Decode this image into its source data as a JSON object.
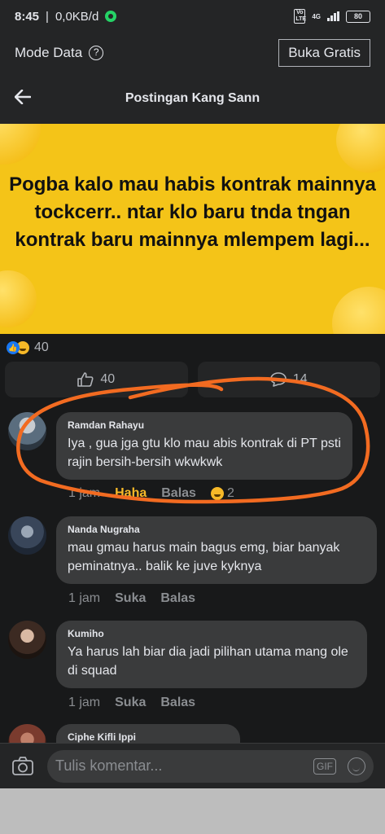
{
  "status_bar": {
    "time": "8:45",
    "speed": "0,0KB/d",
    "network": "4G",
    "volte": "Vo LTE",
    "battery": "80"
  },
  "mode_bar": {
    "label": "Mode Data",
    "help_icon": "question-icon",
    "button": "Buka Gratis"
  },
  "header": {
    "back_icon": "arrow-left-icon",
    "title": "Postingan Kang Sann"
  },
  "post": {
    "text": "Pogba kalo mau habis kontrak mainnya tockcerr.. ntar klo baru tnda tngan kontrak baru mainnya mlempem lagi...",
    "background_color": "#f4c418"
  },
  "reactions": {
    "icons": [
      "like-icon",
      "haha-icon"
    ],
    "count": "40"
  },
  "actions": {
    "like_count": "40",
    "comment_count": "14"
  },
  "comments": [
    {
      "name": "Ramdan Rahayu",
      "text": "Iya , gua jga gtu klo mau abis kontrak di PT psti rajin bersih-bersih wkwkwk",
      "time": "1 jam",
      "reaction_label": "Haha",
      "reply": "Balas",
      "reaction_count": "2"
    },
    {
      "name": "Nanda Nugraha",
      "text": "mau gmau harus main bagus emg, biar banyak peminatnya.. balik ke juve kyknya",
      "time": "1 jam",
      "like": "Suka",
      "reply": "Balas"
    },
    {
      "name": "Kumiho",
      "text": "Ya harus lah biar dia jadi pilihan utama mang ole di squad",
      "time": "1 jam",
      "like": "Suka",
      "reply": "Balas"
    },
    {
      "name": "Ciphe Kifli Ippi"
    }
  ],
  "composer": {
    "placeholder": "Tulis komentar...",
    "gif": "GIF"
  },
  "colors": {
    "background": "#18191a",
    "surface": "#242526",
    "bubble": "#3a3b3c",
    "accent_annotation": "#f26b21",
    "haha": "#f7b928"
  }
}
